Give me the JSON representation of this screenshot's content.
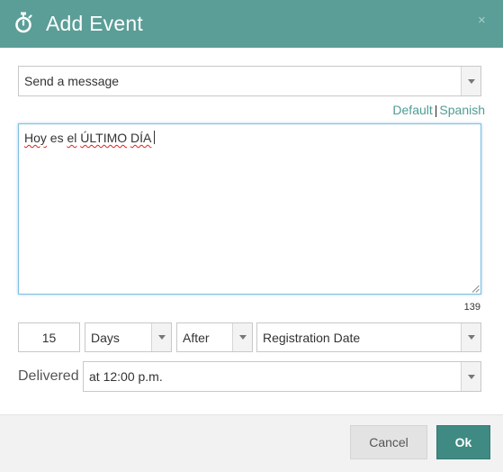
{
  "dialog": {
    "title": "Add Event",
    "close_glyph": "×",
    "icon": "timer-icon"
  },
  "action_select": {
    "value": "Send a message"
  },
  "language": {
    "default_label": "Default",
    "separator": "|",
    "spanish_label": "Spanish"
  },
  "message": {
    "words": [
      "Hoy",
      " es ",
      "el",
      " ",
      "ÚLTIMO",
      " ",
      "DÍA"
    ]
  },
  "char_count": "139",
  "schedule": {
    "amount": "15",
    "unit": "Days",
    "relation": "After",
    "reference": "Registration Date"
  },
  "delivery": {
    "label": "Delivered",
    "time": "at 12:00 p.m."
  },
  "buttons": {
    "cancel": "Cancel",
    "ok": "Ok"
  },
  "colors": {
    "header": "#5a9e97",
    "accent_link": "#4f9c95",
    "ok_button": "#3f8a82",
    "focus_border": "#7fbfe3"
  }
}
